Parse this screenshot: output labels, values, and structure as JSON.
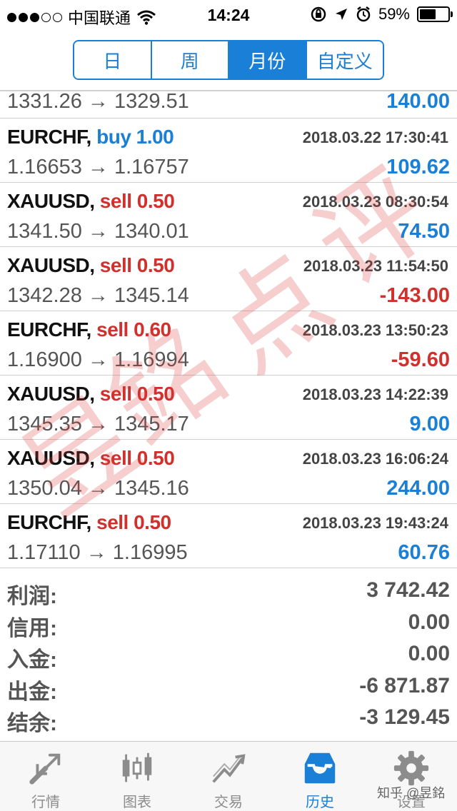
{
  "status_bar": {
    "carrier": "中国联通",
    "time": "14:24",
    "battery": "59%",
    "battery_level": 0.59
  },
  "segments": [
    "日",
    "周",
    "月份",
    "自定义"
  ],
  "active_segment": 2,
  "partial_trade": {
    "prices": "1331.26 → 1329.51",
    "profit": "140.00"
  },
  "trades": [
    {
      "symbol": "EURCHF,",
      "side": "buy 1.00",
      "type": "buy",
      "datetime": "2018.03.22 17:30:41",
      "prices": "1.16653 → 1.16757",
      "profit": "109.62",
      "profit_sign": "pos"
    },
    {
      "symbol": "XAUUSD,",
      "side": "sell 0.50",
      "type": "sell",
      "datetime": "2018.03.23 08:30:54",
      "prices": "1341.50 → 1340.01",
      "profit": "74.50",
      "profit_sign": "pos"
    },
    {
      "symbol": "XAUUSD,",
      "side": "sell 0.50",
      "type": "sell",
      "datetime": "2018.03.23 11:54:50",
      "prices": "1342.28 → 1345.14",
      "profit": "-143.00",
      "profit_sign": "neg"
    },
    {
      "symbol": "EURCHF,",
      "side": "sell 0.60",
      "type": "sell",
      "datetime": "2018.03.23 13:50:23",
      "prices": "1.16900 → 1.16994",
      "profit": "-59.60",
      "profit_sign": "neg"
    },
    {
      "symbol": "XAUUSD,",
      "side": "sell 0.50",
      "type": "sell",
      "datetime": "2018.03.23 14:22:39",
      "prices": "1345.35 → 1345.17",
      "profit": "9.00",
      "profit_sign": "pos"
    },
    {
      "symbol": "XAUUSD,",
      "side": "sell 0.50",
      "type": "sell",
      "datetime": "2018.03.23 16:06:24",
      "prices": "1350.04 → 1345.16",
      "profit": "244.00",
      "profit_sign": "pos"
    },
    {
      "symbol": "EURCHF,",
      "side": "sell 0.50",
      "type": "sell",
      "datetime": "2018.03.23 19:43:24",
      "prices": "1.17110 → 1.16995",
      "profit": "60.76",
      "profit_sign": "pos"
    }
  ],
  "summary": [
    {
      "label": "利润:",
      "value": "3 742.42"
    },
    {
      "label": "信用:",
      "value": "0.00"
    },
    {
      "label": "入金:",
      "value": "0.00"
    },
    {
      "label": "出金:",
      "value": "-6 871.87"
    },
    {
      "label": "结余:",
      "value": "-3 129.45"
    }
  ],
  "tabs": [
    {
      "label": "行情",
      "icon": "quotes-icon"
    },
    {
      "label": "图表",
      "icon": "chart-icon"
    },
    {
      "label": "交易",
      "icon": "trade-icon"
    },
    {
      "label": "历史",
      "icon": "history-icon"
    },
    {
      "label": "设置",
      "icon": "gear-icon"
    }
  ],
  "active_tab": 3,
  "footer_credit": "知乎 @昱銘",
  "watermark_chars": [
    "昱",
    "銘",
    "点",
    "评"
  ],
  "colors": {
    "accent": "#1a7fd6",
    "sell": "#d0312d",
    "positive": "#1a7fd6",
    "negative": "#d0312d"
  }
}
